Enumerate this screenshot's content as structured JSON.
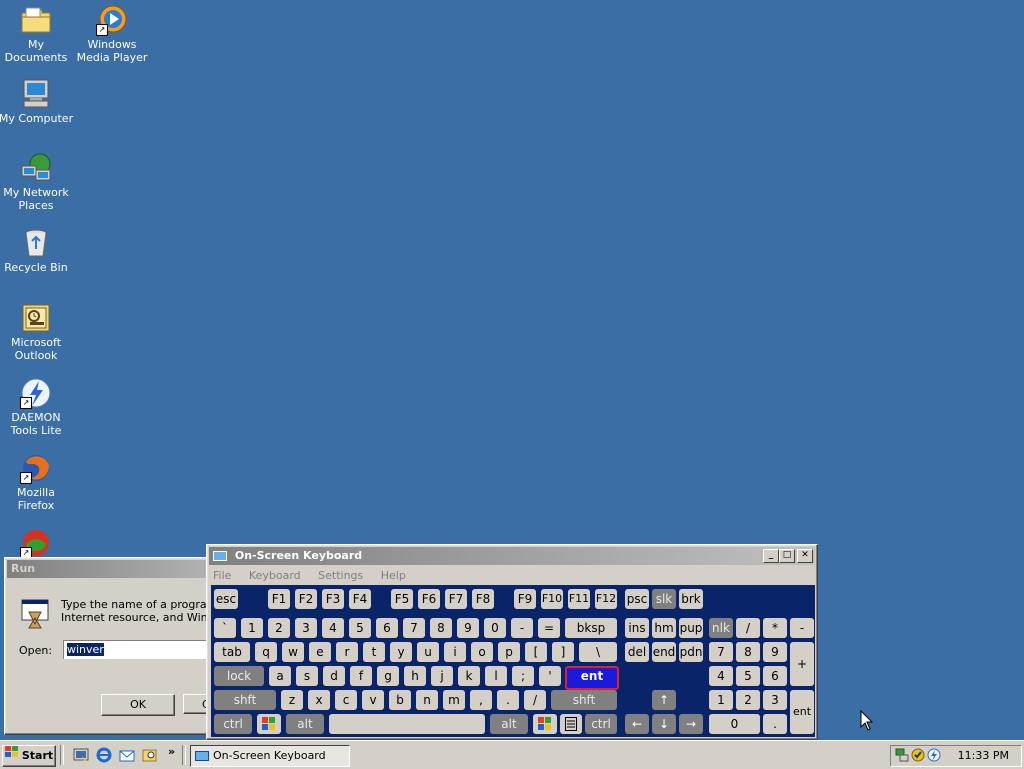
{
  "desktop": {
    "icons": [
      {
        "label": "My Documents"
      },
      {
        "label": "Windows Media Player"
      },
      {
        "label": "My Computer"
      },
      {
        "label": "My Network Places"
      },
      {
        "label": "Recycle Bin"
      },
      {
        "label": "Microsoft Outlook"
      },
      {
        "label": "DAEMON Tools Lite"
      },
      {
        "label": "Mozilla Firefox"
      }
    ]
  },
  "run_dialog": {
    "title": "Run",
    "description_line1": "Type the name of a program,",
    "description_line2": "Internet resource, and Windo",
    "open_label": "Open:",
    "open_value": "winver",
    "ok_label": "OK",
    "cancel_label": "C"
  },
  "osk": {
    "title": "On-Screen Keyboard",
    "menu": [
      "File",
      "Keyboard",
      "Settings",
      "Help"
    ],
    "keys": {
      "esc": "esc",
      "f1": "F1",
      "f2": "F2",
      "f3": "F3",
      "f4": "F4",
      "f5": "F5",
      "f6": "F6",
      "f7": "F7",
      "f8": "F8",
      "f9": "F9",
      "f10": "F10",
      "f11": "F11",
      "f12": "F12",
      "psc": "psc",
      "slk": "slk",
      "brk": "brk",
      "grave": "`",
      "1": "1",
      "2": "2",
      "3": "3",
      "4": "4",
      "5": "5",
      "6": "6",
      "7": "7",
      "8": "8",
      "9": "9",
      "0": "0",
      "minus": "-",
      "equals": "=",
      "bksp": "bksp",
      "ins": "ins",
      "hm": "hm",
      "pup": "pup",
      "nlk": "nlk",
      "np_div": "/",
      "np_mul": "*",
      "np_sub": "-",
      "tab": "tab",
      "q": "q",
      "w": "w",
      "e": "e",
      "r": "r",
      "t": "t",
      "y": "y",
      "u": "u",
      "i": "i",
      "o": "o",
      "p": "p",
      "lbracket": "[",
      "rbracket": "]",
      "backslash": "\\",
      "del": "del",
      "end": "end",
      "pdn": "pdn",
      "np7": "7",
      "np8": "8",
      "np9": "9",
      "np_add": "+",
      "lock": "lock",
      "a": "a",
      "s": "s",
      "d": "d",
      "f": "f",
      "g": "g",
      "h": "h",
      "j": "j",
      "k": "k",
      "l": "l",
      "semicolon": ";",
      "quote": "'",
      "ent": "ent",
      "np4": "4",
      "np5": "5",
      "np6": "6",
      "shft_l": "shft",
      "z": "z",
      "x": "x",
      "c": "c",
      "v": "v",
      "b": "b",
      "n": "n",
      "m": "m",
      "comma": ",",
      "period": ".",
      "slash": "/",
      "shft_r": "shft",
      "np1": "1",
      "np2": "2",
      "np3": "3",
      "np_ent": "ent",
      "ctrl_l": "ctrl",
      "alt_l": "alt",
      "alt_r": "alt",
      "ctrl_r": "ctrl",
      "np0": "0",
      "np_dot": "."
    }
  },
  "taskbar": {
    "start_label": "Start",
    "task_label": "On-Screen Keyboard",
    "clock": "11:33 PM"
  }
}
